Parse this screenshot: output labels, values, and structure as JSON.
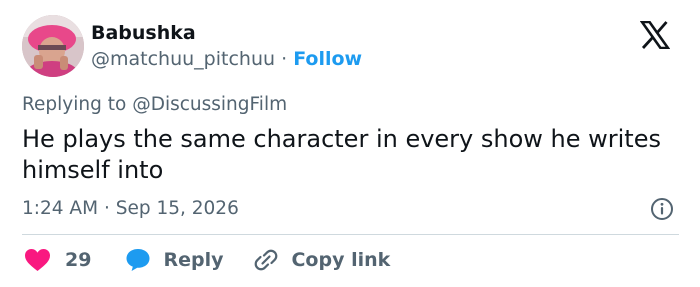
{
  "author": {
    "display_name": "Babushka",
    "handle": "@matchuu_pitchuu",
    "separator": "·",
    "follow_label": "Follow",
    "avatar_icon": "profile-photo-avatar"
  },
  "brand": {
    "logo_icon": "x-logo-icon"
  },
  "reply_context": {
    "prefix": "Replying to",
    "mention": "@DiscussingFilm"
  },
  "tweet": {
    "text": "He plays the same character in every show he writes himself into",
    "time": "1:24 AM",
    "separator": "·",
    "date": "Sep 15, 2026"
  },
  "actions": {
    "like_count": "29",
    "reply_label": "Reply",
    "copy_link_label": "Copy link"
  },
  "colors": {
    "like_red": "#f91880",
    "reply_blue": "#1d9bf0",
    "link_blue": "#1d9bf0",
    "text_dark": "#0f1419",
    "text_gray": "#536471"
  }
}
